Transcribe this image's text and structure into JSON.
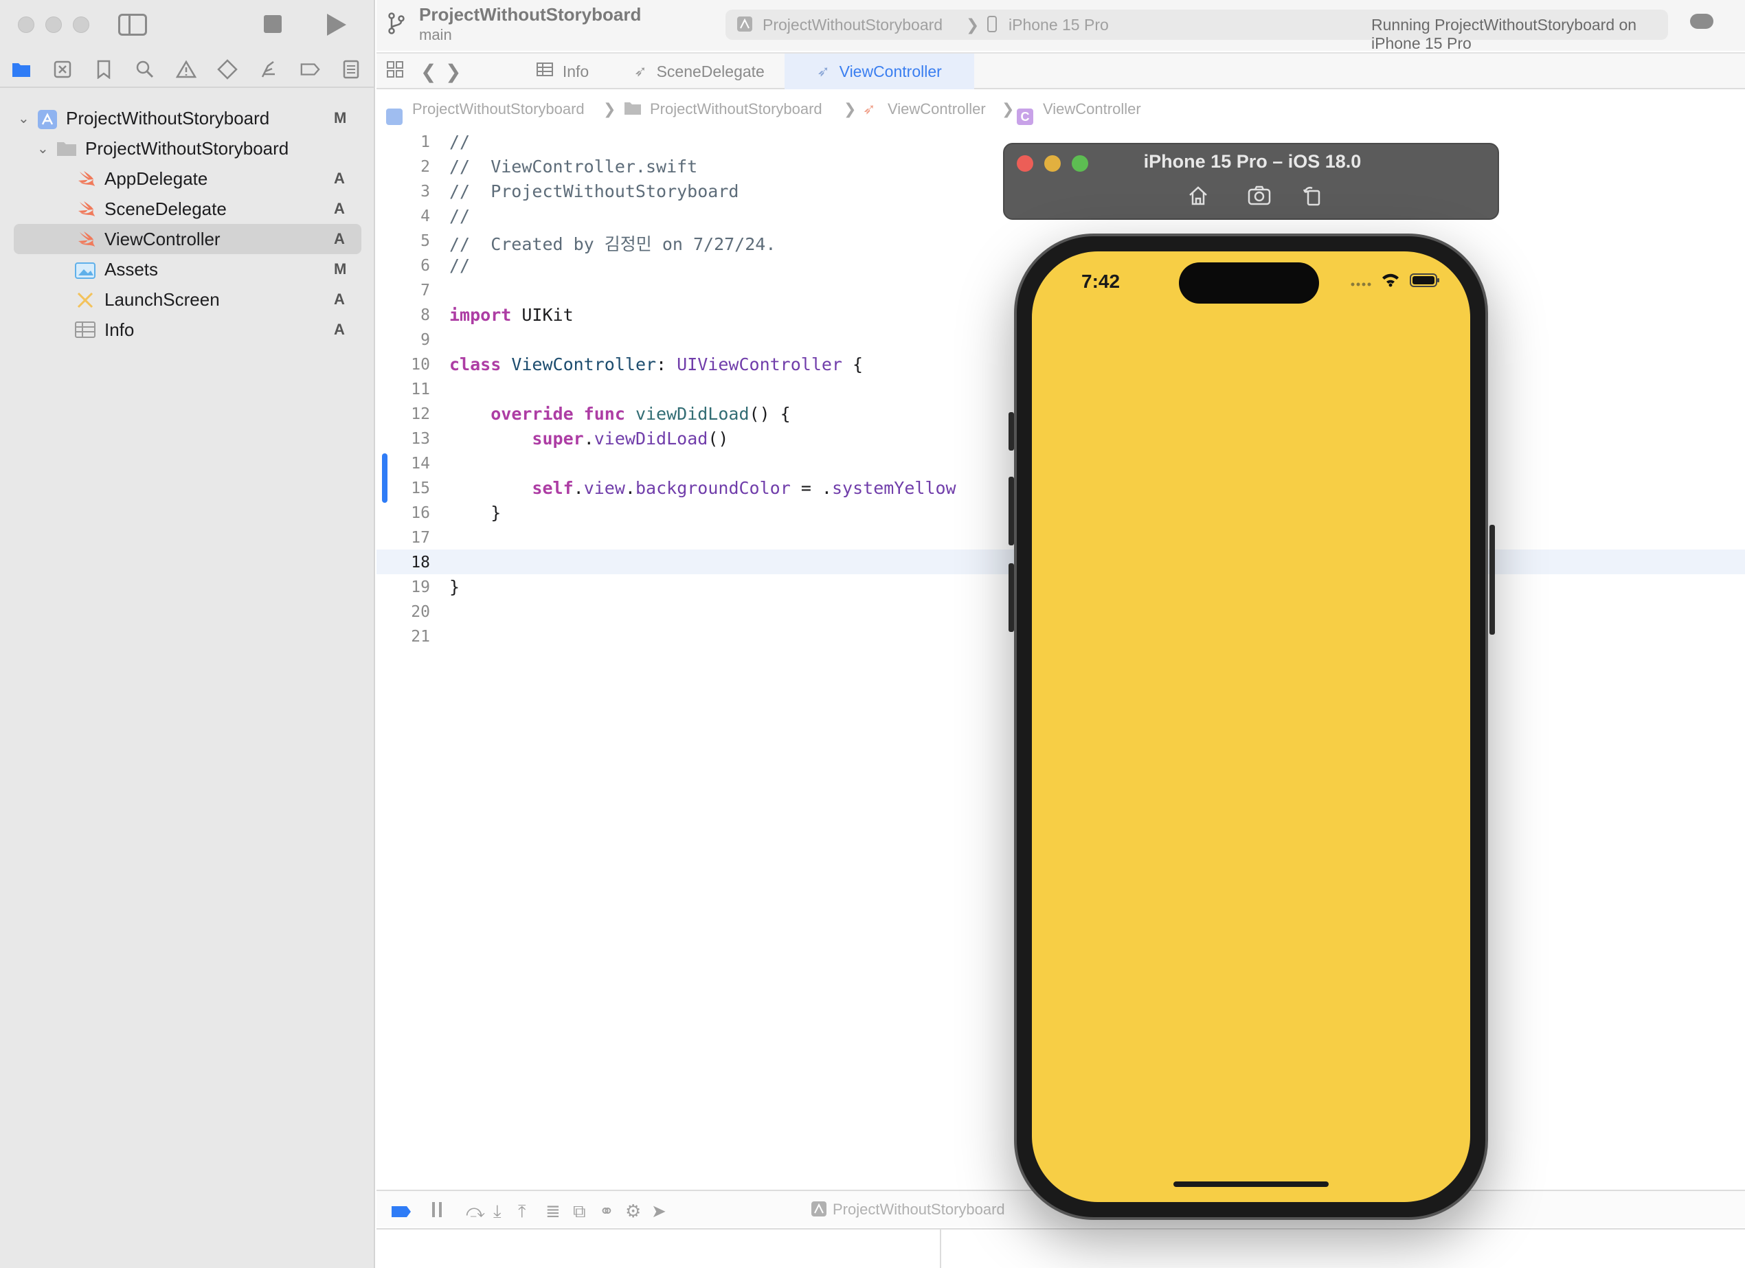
{
  "toolbar": {
    "project_name": "ProjectWithoutStoryboard",
    "branch": "main",
    "scheme": "ProjectWithoutStoryboard",
    "device": "iPhone 15 Pro",
    "status": "Running ProjectWithoutStoryboard on iPhone 15 Pro"
  },
  "navigator": {
    "icons": [
      "folder-icon",
      "source-control-icon",
      "bookmark-icon",
      "find-icon",
      "issue-icon",
      "test-icon",
      "debug-icon",
      "breakpoint-icon",
      "report-icon"
    ],
    "root": {
      "label": "ProjectWithoutStoryboard",
      "status": "M"
    },
    "group": {
      "label": "ProjectWithoutStoryboard"
    },
    "files": [
      {
        "label": "AppDelegate",
        "status": "A",
        "icon": "swift-icon"
      },
      {
        "label": "SceneDelegate",
        "status": "A",
        "icon": "swift-icon"
      },
      {
        "label": "ViewController",
        "status": "A",
        "icon": "swift-icon"
      },
      {
        "label": "Assets",
        "status": "M",
        "icon": "asset-catalog-icon"
      },
      {
        "label": "LaunchScreen",
        "status": "A",
        "icon": "storyboard-icon"
      },
      {
        "label": "Info",
        "status": "A",
        "icon": "plist-icon"
      }
    ]
  },
  "tabs": [
    {
      "label": "Info"
    },
    {
      "label": "SceneDelegate"
    },
    {
      "label": "ViewController"
    }
  ],
  "jumpbar": [
    "ProjectWithoutStoryboard",
    "ProjectWithoutStoryboard",
    "ViewController",
    "ViewController"
  ],
  "editor": {
    "line_numbers": [
      "1",
      "2",
      "3",
      "4",
      "5",
      "6",
      "7",
      "8",
      "9",
      "10",
      "11",
      "12",
      "13",
      "14",
      "15",
      "16",
      "17",
      "18",
      "19",
      "20",
      "21"
    ],
    "current_line": "18",
    "lines": {
      "l1": "//",
      "l2": "//  ViewController.swift",
      "l3": "//  ProjectWithoutStoryboard",
      "l4": "//",
      "l5": "//  Created by 김정민 on 7/27/24.",
      "l6": "//",
      "l8_kw": "import",
      "l8_rest": " UIKit",
      "l10_kw": "class",
      "l10_name": "ViewController",
      "l10_colon": ": ",
      "l10_super": "UIViewController",
      "l10_brace": " {",
      "l12_kw": "override func",
      "l12_fn": "viewDidLoad",
      "l12_rest": "() {",
      "l13_kw": "super",
      "l13_dot": ".",
      "l13_fn": "viewDidLoad",
      "l13_rest": "()",
      "l15_kw": "self",
      "l15_p1": ".",
      "l15_view": "view",
      "l15_p2": ".",
      "l15_bg": "backgroundColor",
      "l15_eq": " = .",
      "l15_color": "systemYellow",
      "l16": "}",
      "l19": "}"
    }
  },
  "debug": {
    "project": "ProjectWithoutStoryboard"
  },
  "simulator": {
    "title": "iPhone 15 Pro – iOS 18.0",
    "time": "7:42",
    "screen_color": "#f7ce45",
    "buttons": [
      "home-icon",
      "screenshot-icon",
      "rotate-icon"
    ]
  }
}
